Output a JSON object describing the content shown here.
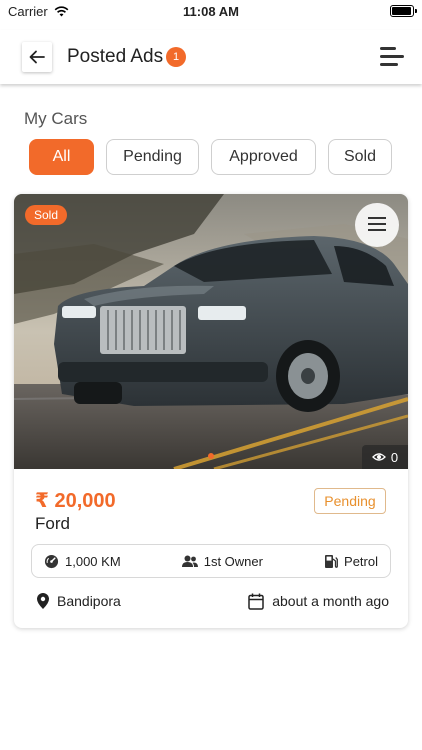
{
  "status_bar": {
    "carrier": "Carrier",
    "time": "11:08 AM"
  },
  "header": {
    "title": "Posted Ads",
    "badge_count": "1",
    "back_icon": "arrow-left-icon",
    "menu_icon": "sort-menu-icon"
  },
  "section": {
    "title": "My Cars"
  },
  "filters": [
    {
      "label": "All",
      "active": true
    },
    {
      "label": "Pending",
      "active": false
    },
    {
      "label": "Approved",
      "active": false
    },
    {
      "label": "Sold",
      "active": false
    }
  ],
  "listing": {
    "sold_tag": "Sold",
    "views": "0",
    "price": "₹ 20,000",
    "name": "Ford",
    "status": "Pending",
    "specs": {
      "km": "1,000 KM",
      "owner": "1st Owner",
      "fuel": "Petrol"
    },
    "location": "Bandipora",
    "posted": "about a month ago"
  },
  "colors": {
    "accent": "#f26a2a",
    "pending": "#e8902e"
  }
}
